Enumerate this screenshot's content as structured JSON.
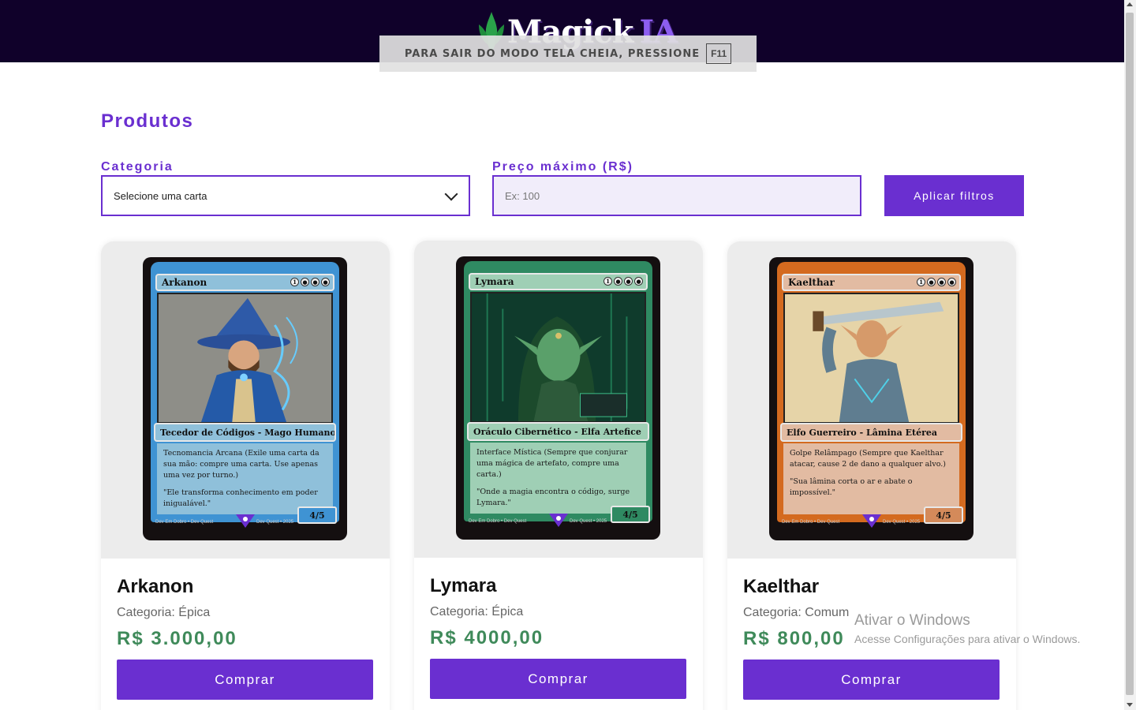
{
  "header": {
    "logo_text": "Magick",
    "logo_accent": "IA",
    "brand_color": "#10012a",
    "accent_color": "#6a2fd0"
  },
  "fullscreen_notice": {
    "text": "PARA SAIR DO MODO TELA CHEIA, PRESSIONE",
    "key": "F11"
  },
  "main": {
    "title": "Produtos",
    "filters": {
      "category_label": "Categoria",
      "category_selected": "Selecione uma carta",
      "price_label": "Preço máximo (R$)",
      "price_placeholder": "Ex: 100",
      "apply_label": "Aplicar filtros"
    },
    "products": [
      {
        "name": "Arkanon",
        "category": "Categoria: Épica",
        "price": "R$ 3.000,00",
        "buy_label": "Comprar",
        "card": {
          "title": "Arkanon",
          "type_line": "Tecedor de Códigos - Mago Humano",
          "rules": "Tecnomancia Arcana (Exile uma carta da sua mão: compre uma carta. Use apenas uma vez por turno.)",
          "flavor": "\"Ele transforma conhecimento em poder inigualável.\"",
          "pt": "4/5",
          "footer_left": "Dev Em Dobro • Dev Quest",
          "footer_right": "Dev Quest • 2025",
          "frame_color": "#3f93d3",
          "box_color": "#8fc0da"
        }
      },
      {
        "name": "Lymara",
        "category": "Categoria: Épica",
        "price": "R$ 4000,00",
        "buy_label": "Comprar",
        "card": {
          "title": "Lymara",
          "type_line": "Oráculo Cibernético - Elfa Artefice",
          "rules": "Interface Mística (Sempre que conjurar uma mágica de artefato, compre uma carta.)",
          "flavor": "\"Onde a magia encontra o código, surge Lymara.\"",
          "pt": "4/5",
          "footer_left": "Dev Em Dobro • Dev Quest",
          "footer_right": "Dev Quest • 2025",
          "frame_color": "#2f8a62",
          "box_color": "#9fcfb5"
        }
      },
      {
        "name": "Kaelthar",
        "category": "Categoria: Comum",
        "price": "R$ 800,00",
        "buy_label": "Comprar",
        "card": {
          "title": "Kaelthar",
          "type_line": "Elfo Guerreiro - Lâmina Etérea",
          "rules": "Golpe Relâmpago (Sempre que Kaelthar atacar, cause 2 de dano a qualquer alvo.)",
          "flavor": "\"Sua lâmina corta o ar e abate o impossível.\"",
          "pt": "4/5",
          "footer_left": "Dev Em Dobro • Dev Quest",
          "footer_right": "Dev Quest • 2025",
          "frame_color": "#d46a1f",
          "box_color": "#e2bba2"
        }
      }
    ]
  },
  "windows_watermark": {
    "title": "Ativar o Windows",
    "subtitle": "Acesse Configurações para ativar o Windows."
  }
}
